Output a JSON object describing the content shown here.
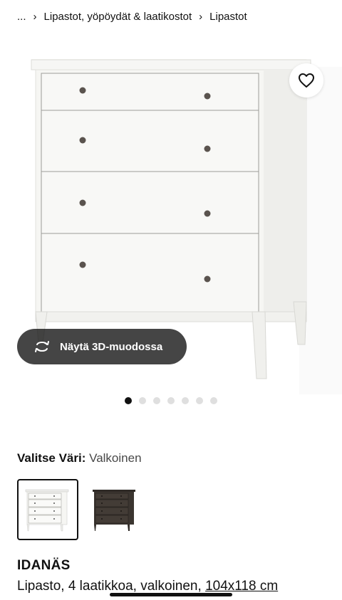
{
  "breadcrumb": {
    "ellipsis": "...",
    "items": [
      {
        "label": "Lipastot, yöpöydät & laatikostot"
      },
      {
        "label": "Lipastot"
      }
    ]
  },
  "gallery": {
    "favorite_icon": "heart-icon",
    "view3d_label": "Näytä 3D-muodossa",
    "view3d_icon": "rotate-3d-icon",
    "dots_total": 7,
    "dot_active_index": 0
  },
  "color_selector": {
    "label": "Valitse Väri:",
    "selected_value": "Valkoinen",
    "options": [
      {
        "name": "Valkoinen",
        "color": "#f4f4f2",
        "selected": true
      },
      {
        "name": "tummanruskea",
        "color": "#3b3530",
        "selected": false
      }
    ]
  },
  "product": {
    "name": "IDANÄS",
    "desc_prefix": "Lipasto, 4 laatikkoa, valkoinen, ",
    "desc_size": "104x118 cm"
  },
  "colors": {
    "text": "#111111",
    "muted": "#484848",
    "pill_bg": "#111111",
    "dot_inactive": "#dfdfdf"
  }
}
